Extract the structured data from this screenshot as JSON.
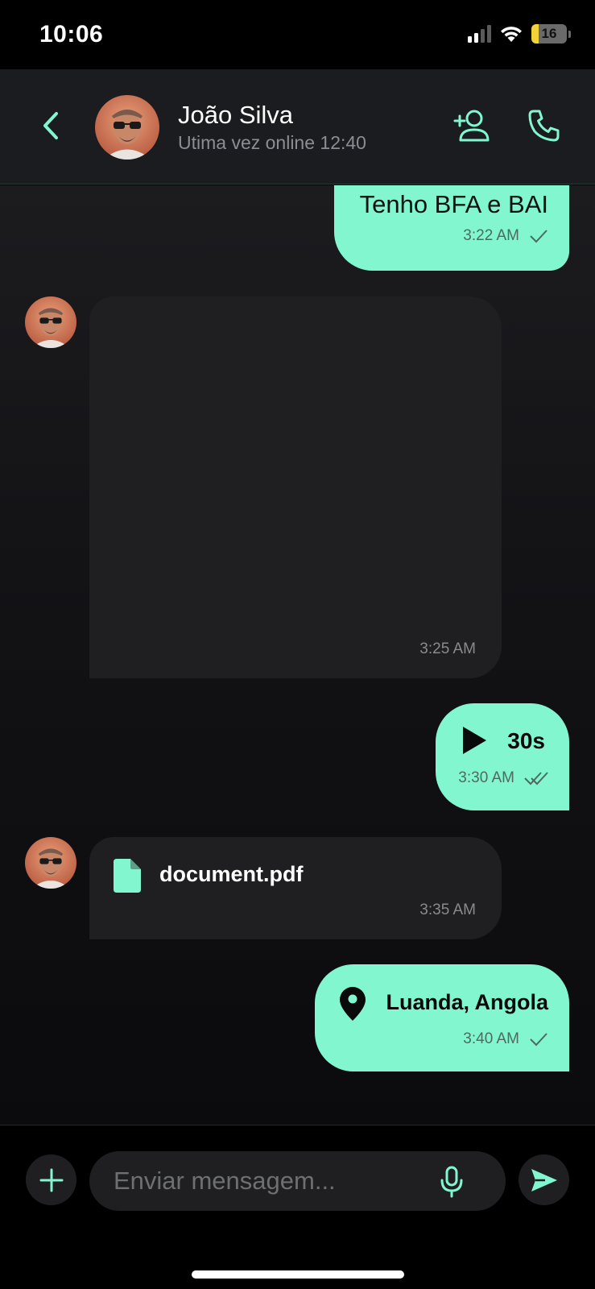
{
  "status_bar": {
    "time": "10:06",
    "battery": "16"
  },
  "header": {
    "back_icon": "chevron-left-icon",
    "contact_name": "João Silva",
    "contact_status": "Utima vez online 12:40",
    "actions": [
      "add-contact-icon",
      "phone-icon"
    ]
  },
  "messages": [
    {
      "direction": "outgoing",
      "type": "text",
      "text": "Tenho BFA e BAI",
      "time": "3:22 AM",
      "receipt": "sent"
    },
    {
      "direction": "incoming",
      "type": "image",
      "time": "3:25 AM"
    },
    {
      "direction": "outgoing",
      "type": "audio",
      "duration": "30s",
      "time": "3:30 AM",
      "receipt": "read"
    },
    {
      "direction": "incoming",
      "type": "file",
      "filename": "document.pdf",
      "time": "3:35 AM"
    },
    {
      "direction": "outgoing",
      "type": "location",
      "location": "Luanda, Angola",
      "time": "3:40 AM",
      "receipt": "sent"
    }
  ],
  "composer": {
    "placeholder": "Enviar mensagem..."
  },
  "colors": {
    "accent": "#82f7cf",
    "bubble_in": "#1f1f21",
    "header_bg": "#1b1c1f"
  }
}
